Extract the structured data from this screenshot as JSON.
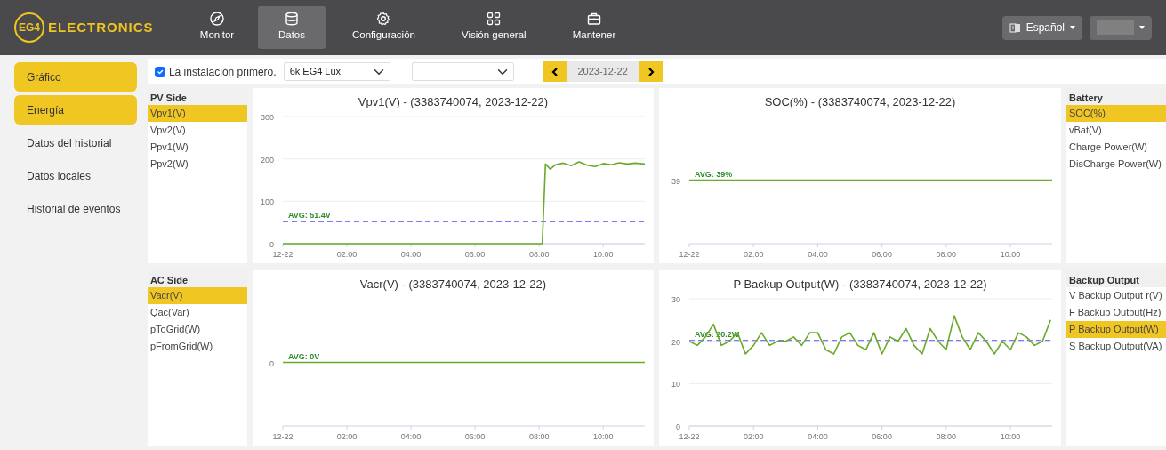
{
  "logo": {
    "mark": "EG4",
    "text": "ELECTRONICS"
  },
  "nav": [
    {
      "label": "Monitor",
      "kind": "compass",
      "selected": false
    },
    {
      "label": "Datos",
      "kind": "database",
      "selected": true
    },
    {
      "label": "Configuración",
      "kind": "gear",
      "selected": false
    },
    {
      "label": "Visión general",
      "kind": "grid",
      "selected": false
    },
    {
      "label": "Mantener",
      "kind": "briefcase",
      "selected": false
    }
  ],
  "language": {
    "label": "Español"
  },
  "sidebar": {
    "items": [
      {
        "label": "Gráfico",
        "selected": true
      },
      {
        "label": "Energía",
        "selected": true
      },
      {
        "label": "Datos del historial",
        "selected": false
      },
      {
        "label": "Datos locales",
        "selected": false
      },
      {
        "label": "Historial de eventos",
        "selected": false
      }
    ]
  },
  "toolbar": {
    "install_first": {
      "label": "La instalación primero.",
      "checked": true
    },
    "device": {
      "value": "6k EG4 Lux"
    },
    "date": {
      "value": "2023-12-22"
    }
  },
  "panels": [
    {
      "list": {
        "title": "PV Side",
        "items": [
          {
            "label": "Vpv1(V)",
            "selected": true
          },
          {
            "label": "Vpv2(V)",
            "selected": false
          },
          {
            "label": "Ppv1(W)",
            "selected": false
          },
          {
            "label": "Ppv2(W)",
            "selected": false
          }
        ]
      },
      "chart_data": {
        "type": "line",
        "title": "Vpv1(V) - (3383740074, 2023-12-22)",
        "x": [
          0,
          1,
          2,
          3,
          4,
          5,
          6,
          7,
          8,
          8.1,
          8.2,
          8.35,
          8.5,
          8.75,
          9,
          9.25,
          9.5,
          9.75,
          10,
          10.25,
          10.5,
          10.75,
          11,
          11.3
        ],
        "series": [
          {
            "color": "#6aaa2a",
            "values": [
              0,
              0,
              0,
              0,
              0,
              0,
              0,
              0,
              0,
              0,
              188,
              176,
              186,
              190,
              184,
              193,
              185,
              182,
              189,
              186,
              191,
              188,
              190,
              188
            ]
          }
        ],
        "xlim": [
          0,
          11.3
        ],
        "ylim": [
          0,
          300
        ],
        "yticks": [
          0,
          100,
          200,
          300
        ],
        "xticks": [
          {
            "value": 0,
            "label": "12-22"
          },
          {
            "value": 2,
            "label": "02:00"
          },
          {
            "value": 4,
            "label": "04:00"
          },
          {
            "value": 6,
            "label": "06:00"
          },
          {
            "value": 8,
            "label": "08:00"
          },
          {
            "value": 10,
            "label": "10:00"
          }
        ],
        "ref_lines": [
          {
            "axis": "y",
            "value": 51.4,
            "label": "AVG: 51.4V",
            "color": "#7b7bf5"
          }
        ]
      }
    },
    {
      "list": {
        "title": "Battery",
        "items": [
          {
            "label": "SOC(%)",
            "selected": true
          },
          {
            "label": "vBat(V)",
            "selected": false
          },
          {
            "label": "Charge Power(W)",
            "selected": false
          },
          {
            "label": "DisCharge Power(W)",
            "selected": false
          }
        ]
      },
      "chart": {
        "title": "SOC(%) - (3383740074, 2023-12-22)",
        "y_label": "39",
        "average_label": "AVG: 39%",
        "x_labels": [
          "12-22",
          "02:00",
          "04:00",
          "06:00",
          "08:00",
          "10:00"
        ]
      }
    },
    {
      "list": {
        "title": "AC Side",
        "items": [
          {
            "label": "Vacr(V)",
            "selected": true
          },
          {
            "label": "Qac(Var)",
            "selected": false
          },
          {
            "label": "pToGrid(W)",
            "selected": false
          },
          {
            "label": "pFromGrid(W)",
            "selected": false
          }
        ]
      },
      "chart": {
        "title": "Vacr(V) - (3383740074, 2023-12-22)",
        "y_label": "0",
        "average_label": "AVG: 0V",
        "x_labels": [
          "12-22",
          "02:00",
          "04:00",
          "06:00",
          "08:00",
          "10:00"
        ]
      }
    },
    {
      "list": {
        "title": "Backup Output",
        "items": [
          {
            "label": "V Backup Output r(V)",
            "selected": false
          },
          {
            "label": "F Backup Output(Hz)",
            "selected": false
          },
          {
            "label": "P Backup Output(W)",
            "selected": true
          },
          {
            "label": "S Backup Output(VA)",
            "selected": false
          }
        ]
      },
      "chart_data": {
        "type": "line",
        "title": "P Backup Output(W) - (3383740074, 2023-12-22)",
        "x": [
          0,
          0.25,
          0.5,
          0.75,
          1,
          1.25,
          1.5,
          1.75,
          2,
          2.25,
          2.5,
          2.75,
          3,
          3.25,
          3.5,
          3.75,
          4,
          4.25,
          4.5,
          4.75,
          5,
          5.25,
          5.5,
          5.75,
          6,
          6.25,
          6.5,
          6.75,
          7,
          7.25,
          7.5,
          7.75,
          8,
          8.25,
          8.5,
          8.75,
          9,
          9.25,
          9.5,
          9.75,
          10,
          10.25,
          10.5,
          10.75,
          11,
          11.25
        ],
        "series": [
          {
            "color": "#6aaa2a",
            "values": [
              20,
              19,
              21,
              24,
              19,
              20,
              22,
              17,
              19,
              22,
              19,
              20,
              20,
              21,
              19,
              22,
              22,
              18,
              17,
              21,
              22,
              19,
              18,
              22,
              17,
              21,
              20,
              23,
              19,
              17,
              23,
              20,
              18,
              26,
              21,
              18,
              22,
              20,
              17,
              20,
              18,
              22,
              21,
              19,
              20,
              25
            ]
          }
        ],
        "xlim": [
          0,
          11.3
        ],
        "ylim": [
          0,
          30
        ],
        "yticks": [
          0,
          10,
          20,
          30
        ],
        "xticks": [
          {
            "value": 0,
            "label": "12-22"
          },
          {
            "value": 2,
            "label": "02:00"
          },
          {
            "value": 4,
            "label": "04:00"
          },
          {
            "value": 6,
            "label": "06:00"
          },
          {
            "value": 8,
            "label": "08:00"
          },
          {
            "value": 10,
            "label": "10:00"
          }
        ],
        "ref_lines": [
          {
            "axis": "y",
            "value": 20.2,
            "label": "AVG: 20.2W",
            "color": "#7b7bf5"
          }
        ]
      }
    }
  ]
}
